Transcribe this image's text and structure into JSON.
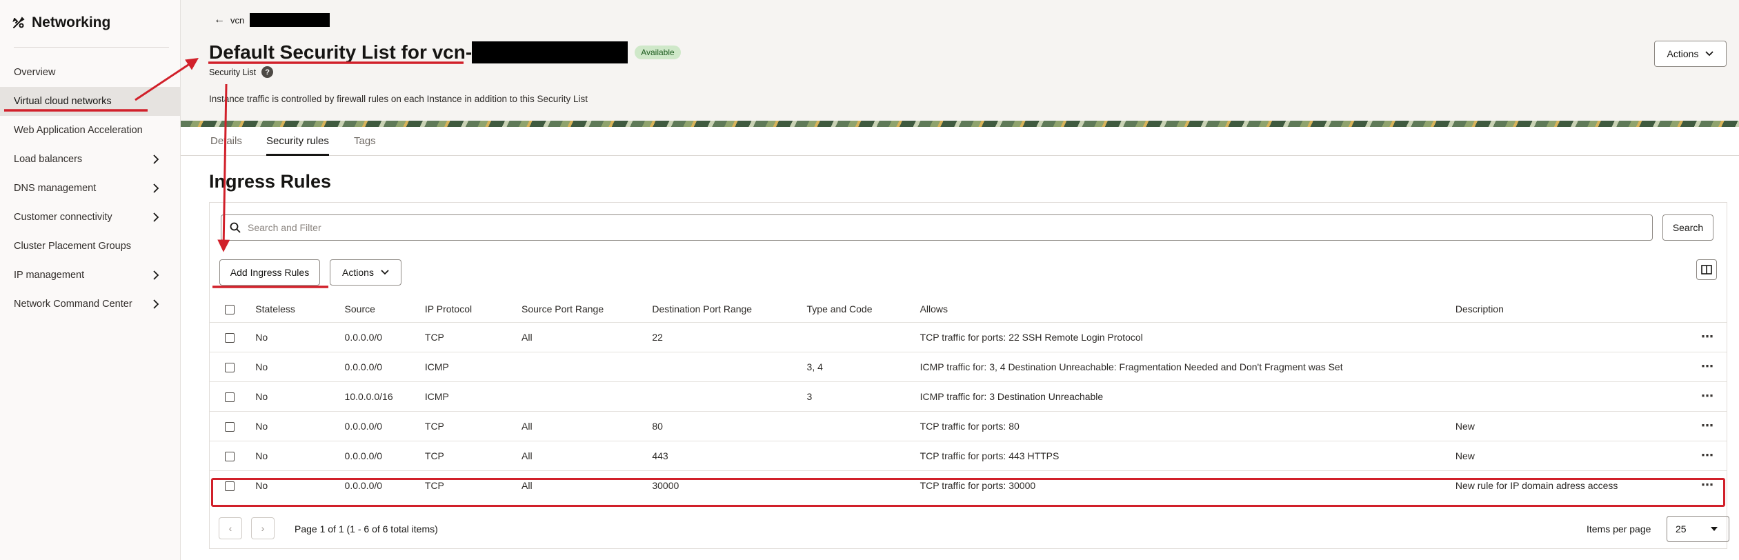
{
  "sidebar": {
    "title": "Networking",
    "items": [
      {
        "label": "Overview",
        "chevron": false,
        "active": false
      },
      {
        "label": "Virtual cloud networks",
        "chevron": false,
        "active": true
      },
      {
        "label": "Web Application Acceleration",
        "chevron": false,
        "active": false
      },
      {
        "label": "Load balancers",
        "chevron": true,
        "active": false
      },
      {
        "label": "DNS management",
        "chevron": true,
        "active": false
      },
      {
        "label": "Customer connectivity",
        "chevron": true,
        "active": false
      },
      {
        "label": "Cluster Placement Groups",
        "chevron": false,
        "active": false
      },
      {
        "label": "IP management",
        "chevron": true,
        "active": false
      },
      {
        "label": "Network Command Center",
        "chevron": true,
        "active": false
      }
    ]
  },
  "header": {
    "back_label": "vcn",
    "title": "Default Security List for vcn-",
    "status_badge": "Available",
    "subtitle": "Security List",
    "help_icon_text": "?",
    "info_text": "Instance traffic is controlled by firewall rules on each Instance in addition to this Security List",
    "actions_label": "Actions"
  },
  "tabs": [
    {
      "label": "Details",
      "active": false
    },
    {
      "label": "Security rules",
      "active": true
    },
    {
      "label": "Tags",
      "active": false
    }
  ],
  "section": {
    "title": "Ingress Rules",
    "search_placeholder": "Search and Filter",
    "search_button": "Search",
    "add_button": "Add Ingress Rules",
    "actions_button": "Actions"
  },
  "table": {
    "columns": [
      "Stateless",
      "Source",
      "IP Protocol",
      "Source Port Range",
      "Destination Port Range",
      "Type and Code",
      "Allows",
      "Description"
    ],
    "rows": [
      [
        "No",
        "0.0.0.0/0",
        "TCP",
        "All",
        "22",
        "",
        "TCP traffic for ports: 22 SSH Remote Login Protocol",
        ""
      ],
      [
        "No",
        "0.0.0.0/0",
        "ICMP",
        "",
        "",
        "3, 4",
        "ICMP traffic for: 3, 4 Destination Unreachable: Fragmentation Needed and Don't Fragment was Set",
        ""
      ],
      [
        "No",
        "10.0.0.0/16",
        "ICMP",
        "",
        "",
        "3",
        "ICMP traffic for: 3 Destination Unreachable",
        ""
      ],
      [
        "No",
        "0.0.0.0/0",
        "TCP",
        "All",
        "80",
        "",
        "TCP traffic for ports: 80",
        "New"
      ],
      [
        "No",
        "0.0.0.0/0",
        "TCP",
        "All",
        "443",
        "",
        "TCP traffic for ports: 443 HTTPS",
        "New"
      ],
      [
        "No",
        "0.0.0.0/0",
        "TCP",
        "All",
        "30000",
        "",
        "TCP traffic for ports: 30000",
        "New rule for IP domain adress access"
      ]
    ],
    "highlighted_row": 5
  },
  "pagination": {
    "text": "Page 1 of 1 (1 - 6 of 6 total items)",
    "items_per_page_label": "Items per page",
    "items_per_page_value": "25"
  },
  "annotation_color": "#d1202a"
}
